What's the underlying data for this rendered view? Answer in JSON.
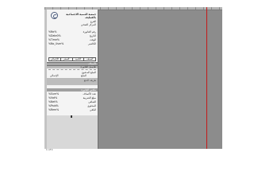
{
  "header": {
    "org_name_line1": "جمعية التنمية الاجتماعية",
    "org_name_line2": "بالقطيف",
    "branch_label": "الفرع",
    "department_label": "المركز الصحي"
  },
  "fields": [
    {
      "value": "%No%",
      "label": "رقم الفاتورة"
    },
    {
      "value": "%Date0%",
      "label": "التاريخ"
    },
    {
      "value": "%Time%",
      "label": "الوقت"
    },
    {
      "value": "%No_User%",
      "label": "الكاشير"
    }
  ],
  "table_headers": [
    "الإجمالي",
    "السعر",
    "الكمية",
    "الصنف"
  ],
  "sections": {
    "items_title": "الأصناف",
    "sub_title": "تفاصيل الفاتورة",
    "payment_title": "طريقة الدفع",
    "totals_title": "ملخص الفاتورة"
  },
  "payment": {
    "row1_label": "المبلغ المدفوع",
    "row2_left": "الإجمالي",
    "row2_right": "المبلغ"
  },
  "totals": [
    {
      "value": "%Sum%",
      "label": "عدد الأصناف"
    },
    {
      "value": "%Vat%",
      "label": "مبلغ الضريبة"
    },
    {
      "value": "%Net%",
      "label": "الصافي"
    },
    {
      "value": "%Paid%",
      "label": "المدفوع"
    },
    {
      "value": "%Rem%",
      "label": "الباقي"
    }
  ],
  "footer": {
    "left_label": "1 of 1"
  },
  "colors": {
    "canvas": "#8c8c8c",
    "guide": "#c41a1a",
    "panel": "#f4f4f4"
  }
}
